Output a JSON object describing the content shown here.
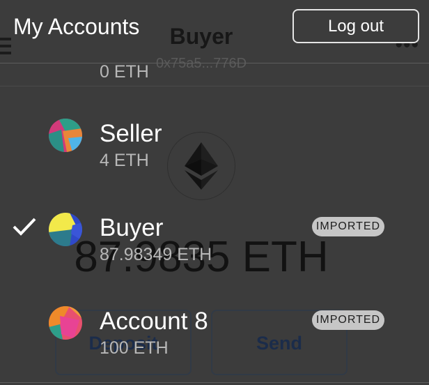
{
  "background": {
    "account_name": "Buyer",
    "address": "0x75a5...776D",
    "balance": "87.9835 ETH",
    "deposit_label": "Deposit",
    "send_label": "Send",
    "menu_icon": "hamburger-icon",
    "options_icon": "kebab-icon",
    "token_icon": "ethereum-icon"
  },
  "menu": {
    "title": "My Accounts",
    "logout_label": "Log out",
    "partial_account_balance": "0 ETH",
    "accounts": [
      {
        "name": "Seller",
        "balance": "4 ETH",
        "selected": false,
        "badge": ""
      },
      {
        "name": "Buyer",
        "balance": "87.98349 ETH",
        "selected": true,
        "badge": "IMPORTED"
      },
      {
        "name": "Account 8",
        "balance": "100 ETH",
        "selected": false,
        "badge": "IMPORTED"
      }
    ]
  },
  "colors": {
    "overlay": "#3c3c3c",
    "text_primary": "#ffffff",
    "text_secondary": "#b8b8b8",
    "badge_bg": "#c6c6c6"
  }
}
